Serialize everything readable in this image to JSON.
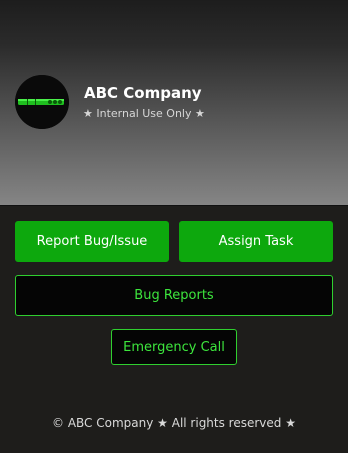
{
  "brand": {
    "name": "ABC Company",
    "tagline": "★ Internal Use Only ★"
  },
  "actions": {
    "report_bug": "Report Bug/Issue",
    "assign_task": "Assign Task",
    "bug_reports": "Bug Reports",
    "emergency_call": "Emergency Call"
  },
  "footer": {
    "text": "© ABC Company ★ All rights reserved ★"
  },
  "colors": {
    "accent": "#0da80d",
    "accent_text": "#3de63d",
    "background": "#1e1d1b"
  },
  "icons": {
    "logo": "pipe-logo-icon"
  }
}
